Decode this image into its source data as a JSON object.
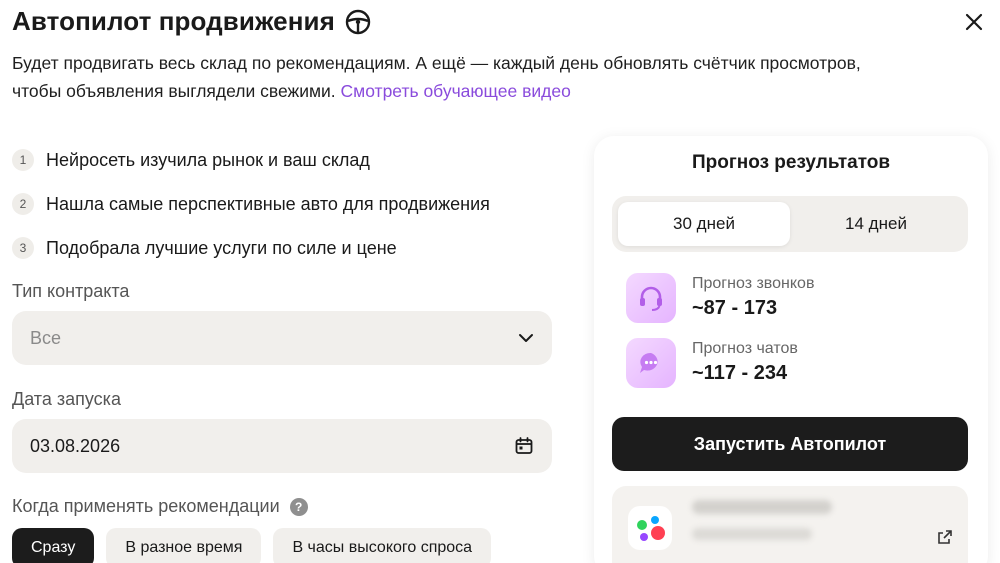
{
  "header": {
    "title": "Автопилот продвижения",
    "title_icon": "steering-wheel-icon",
    "close_icon": "close-icon"
  },
  "description": {
    "text": "Будет продвигать весь склад по рекомендациям. А ещё — каждый день обновлять счётчик просмотров, чтобы объявления выглядели свежими.",
    "link": "Смотреть обучающее видео"
  },
  "steps": [
    {
      "num": "1",
      "text": "Нейросеть изучила рынок и ваш склад"
    },
    {
      "num": "2",
      "text": "Нашла самые перспективные авто для продвижения"
    },
    {
      "num": "3",
      "text": "Подобрала лучшие услуги по силе и цене"
    }
  ],
  "contract": {
    "label": "Тип контракта",
    "value": "Все"
  },
  "launch_date": {
    "label": "Дата запуска",
    "value": "03.08.2026"
  },
  "apply": {
    "label": "Когда применять рекомендации",
    "help": "?",
    "options": [
      "Сразу",
      "В разное время",
      "В часы высокого спроса"
    ],
    "selected": "Сразу"
  },
  "forecast": {
    "title": "Прогноз результатов",
    "tabs": [
      "30 дней",
      "14 дней"
    ],
    "active_tab": "30 дней",
    "calls": {
      "label": "Прогноз звонков",
      "value": "~87 - 173",
      "icon": "headset-icon"
    },
    "chats": {
      "label": "Прогноз чатов",
      "value": "~117 - 234",
      "icon": "chat-bubble-icon"
    },
    "launch_button": "Запустить Автопилот"
  },
  "colors": {
    "accent": "#8a4bdc",
    "dark": "#1c1c1c",
    "field_bg": "#f1efec"
  }
}
